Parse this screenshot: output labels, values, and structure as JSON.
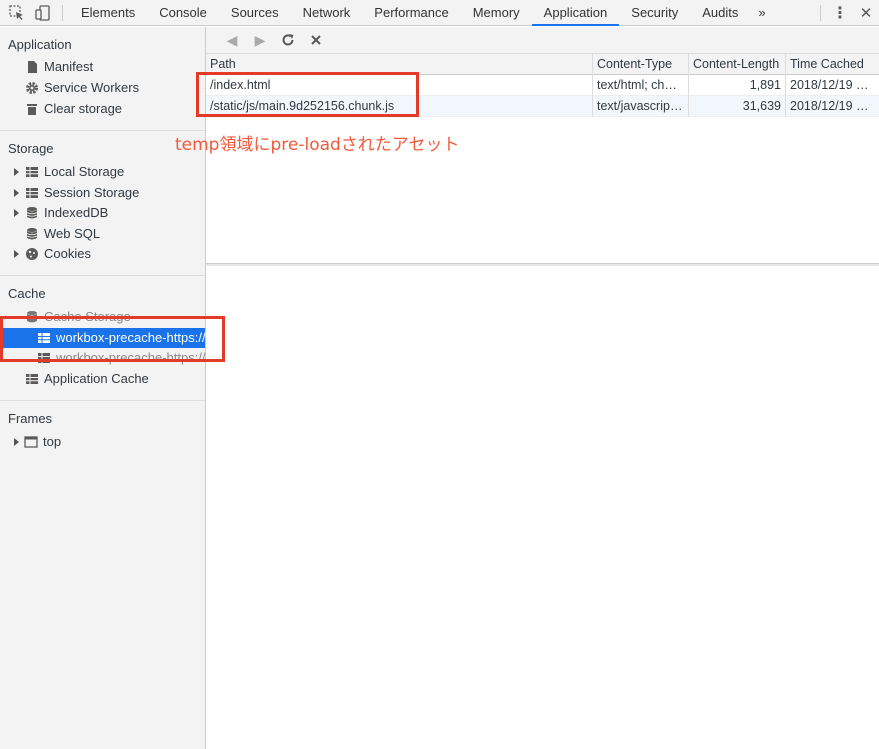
{
  "topbar": {
    "tabs": [
      "Elements",
      "Console",
      "Sources",
      "Network",
      "Performance",
      "Memory",
      "Application",
      "Security",
      "Audits"
    ],
    "active_tab": "Application",
    "more": "»",
    "menu_icon": "⋮",
    "close_icon": "✕"
  },
  "sidebar": {
    "application": {
      "title": "Application",
      "items": [
        "Manifest",
        "Service Workers",
        "Clear storage"
      ]
    },
    "storage": {
      "title": "Storage",
      "items": [
        "Local Storage",
        "Session Storage",
        "IndexedDB",
        "Web SQL",
        "Cookies"
      ]
    },
    "cache": {
      "title": "Cache",
      "cache_storage": "Cache Storage",
      "cache_items": [
        "workbox-precache-https://",
        "workbox-precache-https://"
      ],
      "app_cache": "Application Cache"
    },
    "frames": {
      "title": "Frames",
      "items": [
        "top"
      ]
    }
  },
  "table": {
    "headers": [
      "Path",
      "Content-Type",
      "Content-Length",
      "Time Cached"
    ],
    "rows": [
      [
        "/index.html",
        "text/html; ch…",
        "1,891",
        "2018/12/19 0…"
      ],
      [
        "/static/js/main.9d252156.chunk.js",
        "text/javascrip…",
        "31,639",
        "2018/12/19 0…"
      ]
    ]
  },
  "annotation": "temp領域にpre-loadされたアセット",
  "colors": {
    "accent": "#1a73e8",
    "annotation": "#e53a2a"
  }
}
